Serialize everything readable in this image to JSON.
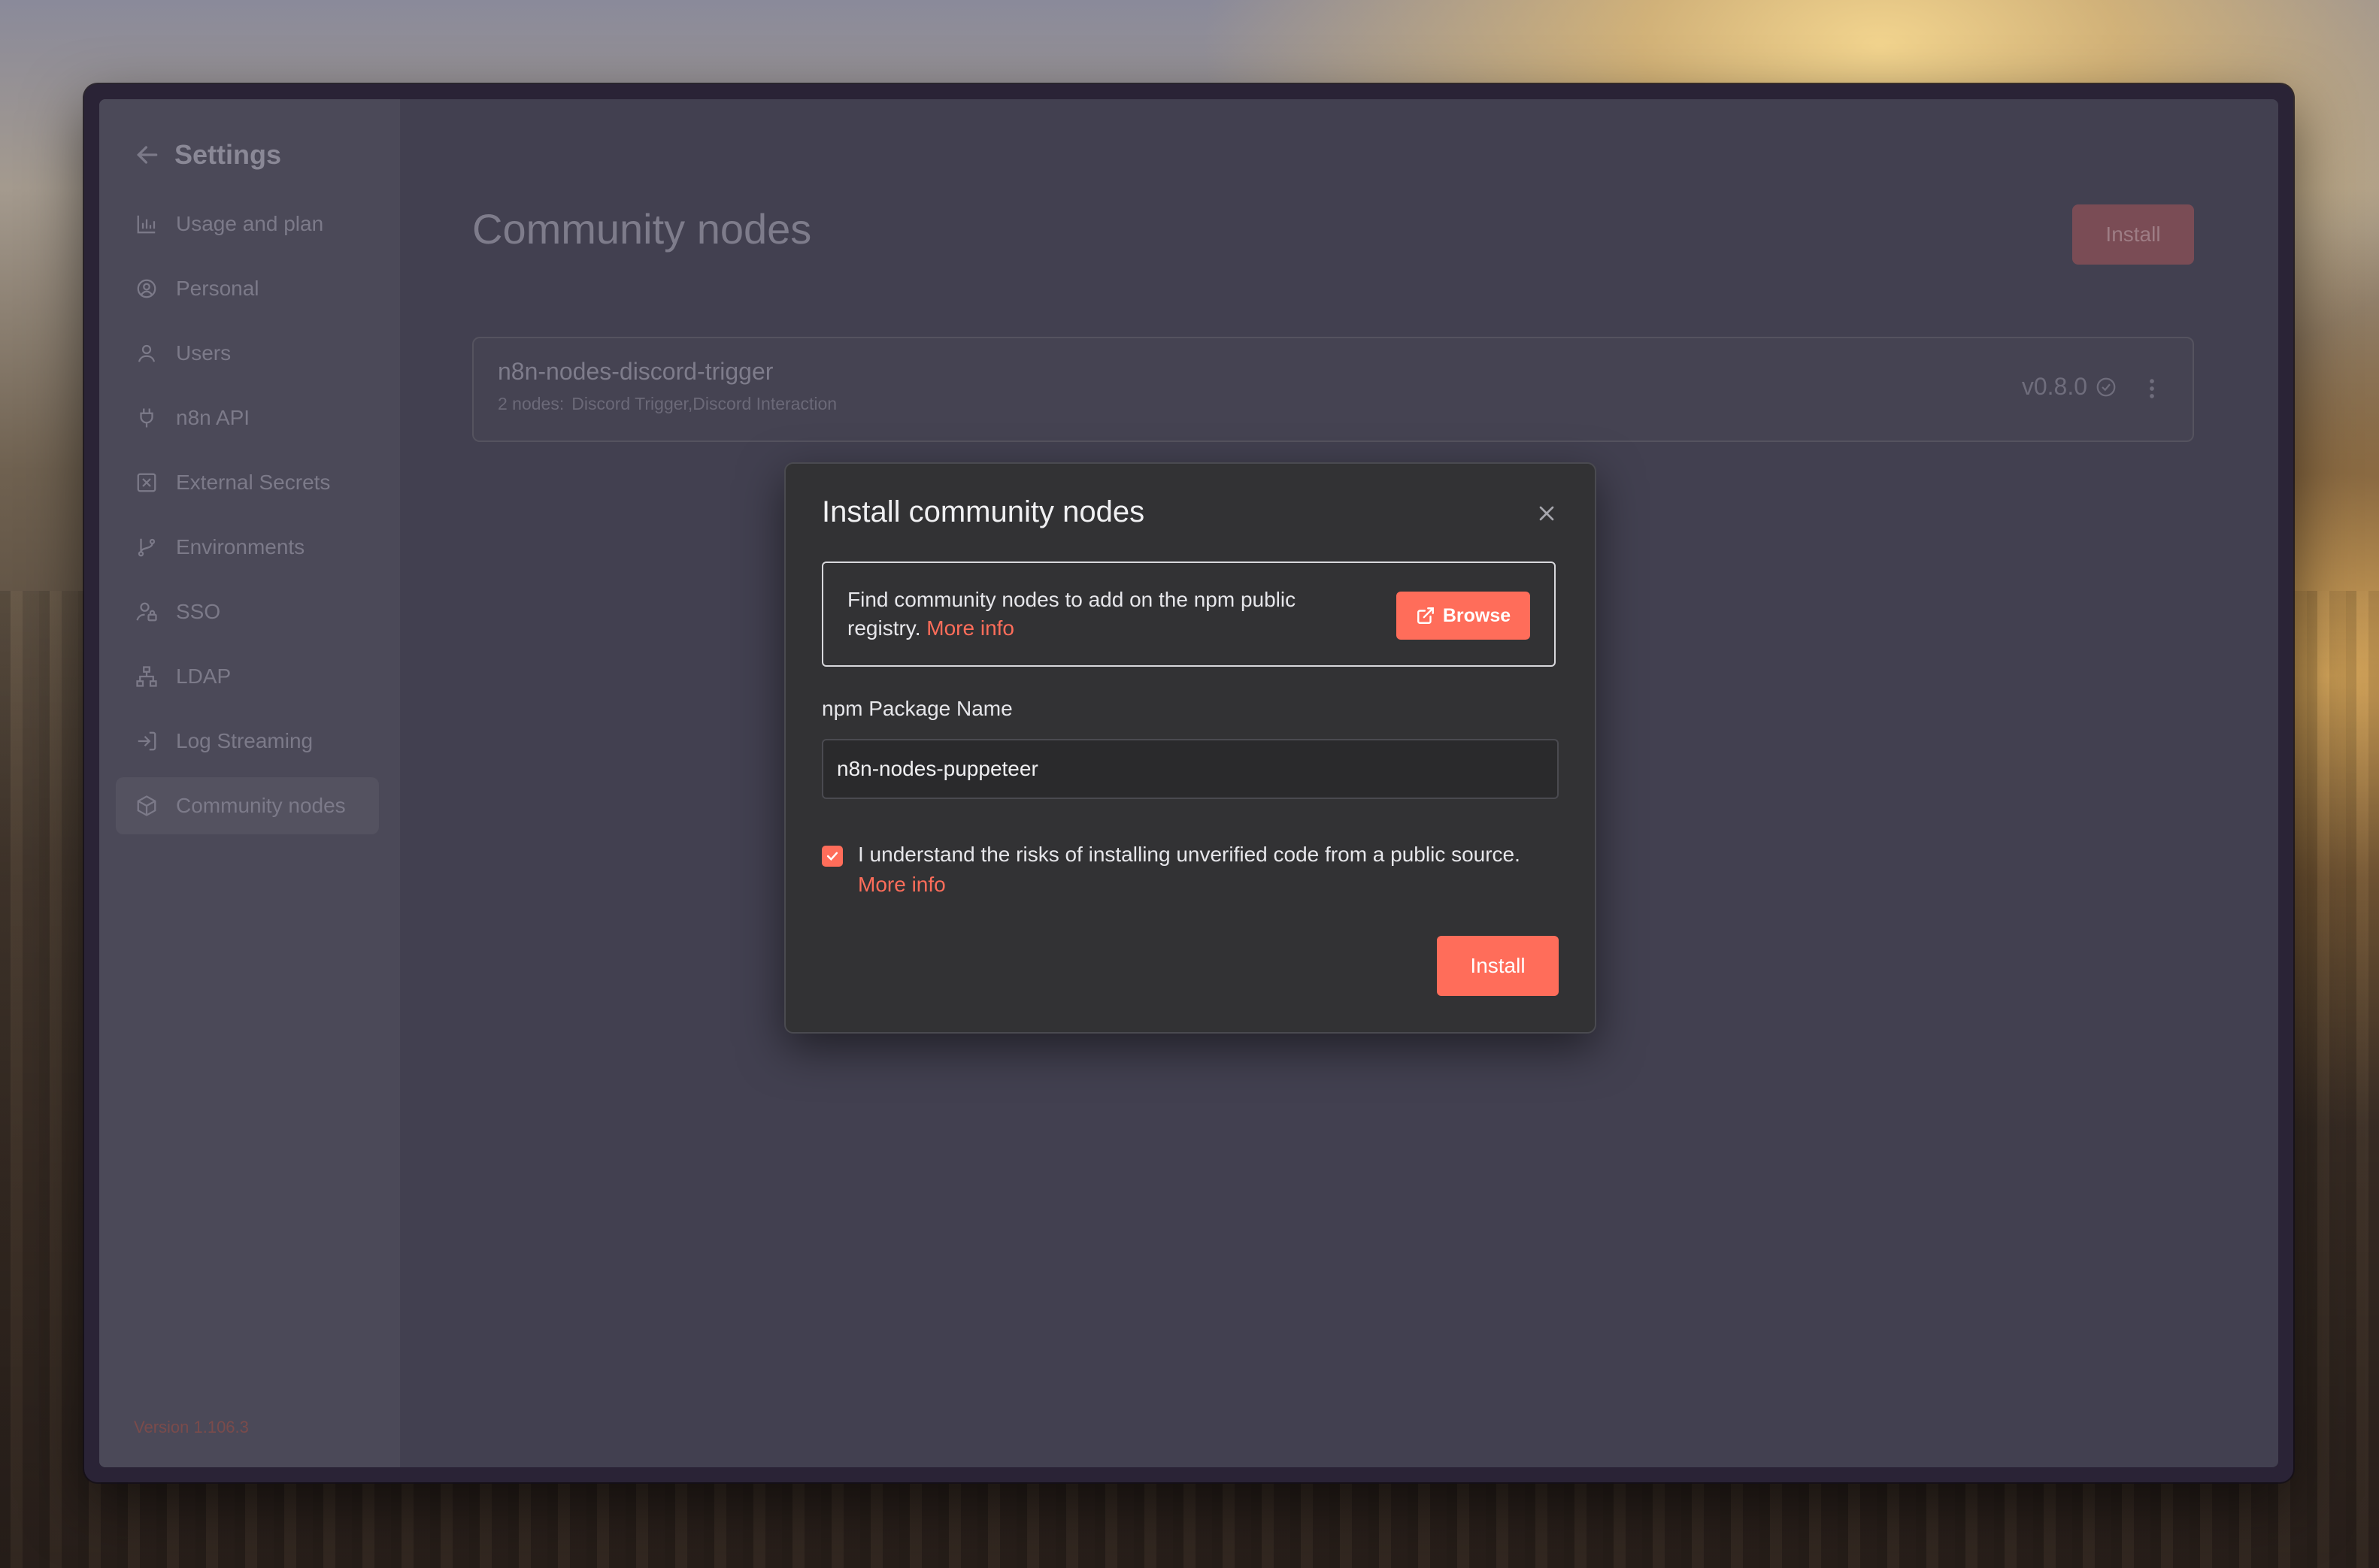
{
  "sidebar": {
    "title": "Settings",
    "items": [
      {
        "label": "Usage and plan",
        "icon": "bar-chart-icon"
      },
      {
        "label": "Personal",
        "icon": "user-circle-icon"
      },
      {
        "label": "Users",
        "icon": "user-icon"
      },
      {
        "label": "n8n API",
        "icon": "plug-icon"
      },
      {
        "label": "External Secrets",
        "icon": "vault-icon"
      },
      {
        "label": "Environments",
        "icon": "git-branch-icon"
      },
      {
        "label": "SSO",
        "icon": "user-lock-icon"
      },
      {
        "label": "LDAP",
        "icon": "network-icon"
      },
      {
        "label": "Log Streaming",
        "icon": "sign-in-icon"
      },
      {
        "label": "Community nodes",
        "icon": "cube-icon"
      }
    ],
    "active": "Community nodes",
    "version": "Version 1.106.3"
  },
  "main": {
    "title": "Community nodes",
    "install_label": "Install",
    "package": {
      "name": "n8n-nodes-discord-trigger",
      "nodes_count": "2 nodes:",
      "nodes": "Discord Trigger,Discord Interaction",
      "version": "v0.8.0"
    }
  },
  "modal": {
    "title": "Install community nodes",
    "info_text": "Find community nodes to add on the npm public registry.",
    "info_link": "More info",
    "browse_label": "Browse",
    "field_label": "npm Package Name",
    "field_value": "n8n-nodes-puppeteer",
    "consent_text": "I understand the risks of installing unverified code from a public source.",
    "consent_link": "More info",
    "consent_checked": true,
    "install_label": "Install"
  },
  "colors": {
    "accent": "#ff6d5a",
    "modal_bg": "#323234"
  }
}
